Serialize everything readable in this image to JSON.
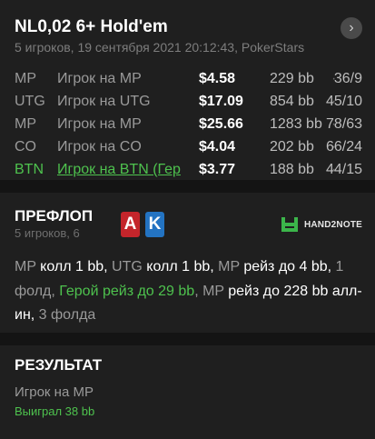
{
  "hand": {
    "title": "NL0,02 6+ Hold'em",
    "subtitle": "5 игроков, 19 сентября 2021 20:12:43, PokerStars",
    "next_icon": "chevron-right-icon"
  },
  "players": [
    {
      "pos": "MP",
      "name": "Игрок на MP",
      "stack": "$4.58",
      "bb": "229 bb",
      "dot": "·",
      "stats": "36/9"
    },
    {
      "pos": "UTG",
      "name": "Игрок на UTG",
      "stack": "$17.09",
      "bb": "854 bb",
      "dot": "·",
      "stats": "45/10"
    },
    {
      "pos": "MP",
      "name": "Игрок на MP",
      "stack": "$25.66",
      "bb": "1283 bb",
      "dot": "·",
      "stats": "78/63"
    },
    {
      "pos": "CO",
      "name": "Игрок на CO",
      "stack": "$4.04",
      "bb": "202 bb",
      "dot": "·",
      "stats": "66/24"
    },
    {
      "pos": "BTN",
      "name": "Игрок на BTN (Гер",
      "stack": "$3.77",
      "bb": "188 bb",
      "dot": "·",
      "stats": "44/15",
      "hero": true
    }
  ],
  "preflop": {
    "title": "ПРЕФЛОП",
    "subtitle": "5 игроков, 6",
    "cards": [
      "A",
      "K"
    ],
    "brand": "HAND2NOTE",
    "actions": [
      {
        "t": "MP",
        "c": "p"
      },
      {
        "t": " колл 1 bb, ",
        "c": ""
      },
      {
        "t": "UTG",
        "c": "p"
      },
      {
        "t": " колл 1 bb, ",
        "c": ""
      },
      {
        "t": "MP",
        "c": "p"
      },
      {
        "t": " рейз до 4 bb, ",
        "c": ""
      },
      {
        "t": "1 фолд, ",
        "c": "p"
      },
      {
        "t": "Герой рейз до 29 bb",
        "c": "h"
      },
      {
        "t": ", ",
        "c": "p"
      },
      {
        "t": "MP",
        "c": "p"
      },
      {
        "t": " рейз до 228 bb алл-ин, ",
        "c": ""
      },
      {
        "t": "3 фолда",
        "c": "p"
      }
    ]
  },
  "result": {
    "title": "РЕЗУЛЬТАТ",
    "winner": "Игрок на MP",
    "won": "Выиграл 38 bb"
  },
  "colors": {
    "hero": "#4ec24e",
    "card_a": "#c4252b",
    "card_k": "#2373c2",
    "background": "#1f1f1f"
  }
}
